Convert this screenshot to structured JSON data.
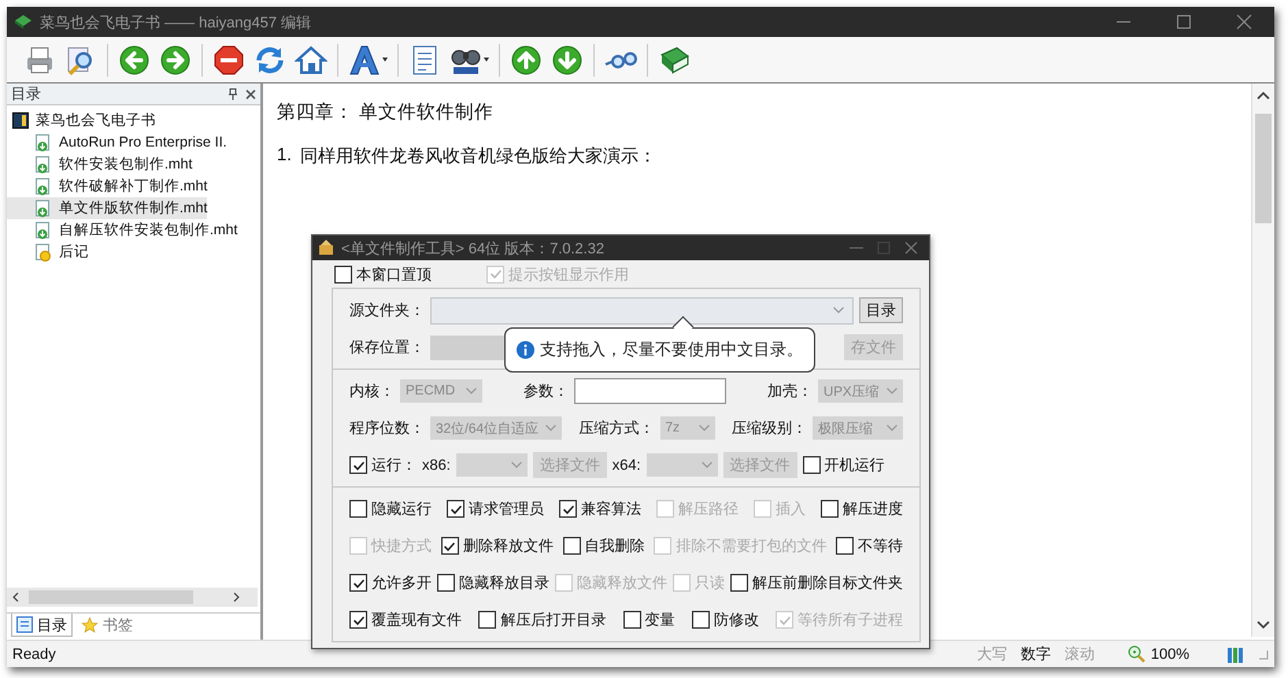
{
  "window": {
    "title": "菜鸟也会飞电子书 —— haiyang457 编辑"
  },
  "toolbar": [
    [
      {
        "kind": "print",
        "dropdown": false
      },
      {
        "kind": "preview",
        "dropdown": false
      }
    ],
    [
      {
        "kind": "back",
        "dropdown": false
      },
      {
        "kind": "forward",
        "dropdown": false
      }
    ],
    [
      {
        "kind": "stop",
        "dropdown": false
      },
      {
        "kind": "refresh",
        "dropdown": false
      },
      {
        "kind": "home",
        "dropdown": false
      }
    ],
    [
      {
        "kind": "font",
        "dropdown": true
      }
    ],
    [
      {
        "kind": "list",
        "dropdown": false
      },
      {
        "kind": "find",
        "dropdown": true
      }
    ],
    [
      {
        "kind": "up",
        "dropdown": false
      },
      {
        "kind": "down",
        "dropdown": false
      }
    ],
    [
      {
        "kind": "link",
        "dropdown": false
      }
    ],
    [
      {
        "kind": "book",
        "dropdown": false
      }
    ]
  ],
  "sidebar": {
    "title": "目录",
    "tree": [
      {
        "label": "菜鸟也会飞电子书",
        "kind": "book",
        "selected": false,
        "children": [
          {
            "label": "AutoRun Pro Enterprise II.",
            "kind": "page",
            "selected": false
          },
          {
            "label": "软件安装包制作.mht",
            "kind": "page",
            "selected": false
          },
          {
            "label": "软件破解补丁制作.mht",
            "kind": "page",
            "selected": false
          },
          {
            "label": "单文件版软件制作.mht",
            "kind": "page",
            "selected": true
          },
          {
            "label": "自解压软件安装包制作.mht",
            "kind": "page",
            "selected": false
          },
          {
            "label": "后记",
            "kind": "note",
            "selected": false
          }
        ]
      }
    ],
    "tabs": [
      {
        "label": "目录",
        "kind": "contents",
        "selected": true
      },
      {
        "label": "书签",
        "kind": "bookmarks",
        "selected": false
      }
    ]
  },
  "content": {
    "heading": "第四章： 单文件软件制作",
    "items": [
      {
        "number": "1.",
        "text": "同样用软件龙卷风收音机绿色版给大家演示："
      }
    ],
    "dialog": {
      "title": "<单文件制作工具> 64位 版本：7.0.2.32",
      "top_options": [
        {
          "label": "本窗口置顶",
          "checked": false,
          "disabled": false
        },
        {
          "label": "提示按钮显示作用",
          "checked": true,
          "disabled": true
        }
      ],
      "source": {
        "label": "源文件夹：",
        "button": "目录"
      },
      "save": {
        "label": "保存位置：",
        "button": "存文件"
      },
      "tooltip": "支持拖入，尽量不要使用中文目录。",
      "core": {
        "label": "内核：",
        "value": "PECMD"
      },
      "params": {
        "label": "参数："
      },
      "shell": {
        "label": "加壳：",
        "value": "UPX压缩"
      },
      "bits": {
        "label": "程序位数：",
        "value": "32位/64位自适应"
      },
      "method": {
        "label": "压缩方式：",
        "value": "7z"
      },
      "compression_level": {
        "label": "压缩级别：",
        "value": "极限压缩"
      },
      "run": {
        "label": "运行：",
        "checked": true,
        "x86_label": "x86:",
        "x86_button": "选择文件",
        "x64_label": "x64:",
        "x64_button": "选择文件"
      },
      "autostart": {
        "label": "开机运行",
        "checked": false
      },
      "options": [
        [
          {
            "label": "隐藏运行",
            "checked": false,
            "disabled": false
          },
          {
            "label": "请求管理员",
            "checked": true,
            "disabled": false
          },
          {
            "label": "兼容算法",
            "checked": true,
            "disabled": false
          },
          {
            "label": "解压路径",
            "checked": false,
            "disabled": true
          },
          {
            "label": "插入",
            "checked": false,
            "disabled": true
          },
          {
            "label": "解压进度",
            "checked": false,
            "disabled": false
          }
        ],
        [
          {
            "label": "快捷方式",
            "checked": false,
            "disabled": true
          },
          {
            "label": "删除释放文件",
            "checked": true,
            "disabled": false
          },
          {
            "label": "自我删除",
            "checked": false,
            "disabled": false
          },
          {
            "label": "排除不需要打包的文件",
            "checked": false,
            "disabled": true
          },
          {
            "label": "不等待",
            "checked": false,
            "disabled": false
          }
        ],
        [
          {
            "label": "允许多开",
            "checked": true,
            "disabled": false
          },
          {
            "label": "隐藏释放目录",
            "checked": false,
            "disabled": false
          },
          {
            "label": "隐藏释放文件",
            "checked": false,
            "disabled": true
          },
          {
            "label": "只读",
            "checked": false,
            "disabled": true
          },
          {
            "label": "解压前删除目标文件夹",
            "checked": false,
            "disabled": false
          }
        ],
        [
          {
            "label": "覆盖现有文件",
            "checked": true,
            "disabled": false
          },
          {
            "label": "解压后打开目录",
            "checked": false,
            "disabled": false
          },
          {
            "label": "变量",
            "checked": false,
            "disabled": false
          },
          {
            "label": "防修改",
            "checked": false,
            "disabled": false
          },
          {
            "label": "等待所有子进程",
            "checked": true,
            "disabled": true
          }
        ]
      ]
    }
  },
  "status_bar": {
    "text": "Ready",
    "indicators": [
      {
        "label": "大写",
        "active": false
      },
      {
        "label": "数字",
        "active": true
      },
      {
        "label": "滚动",
        "active": false
      }
    ],
    "zoom": "100%"
  }
}
